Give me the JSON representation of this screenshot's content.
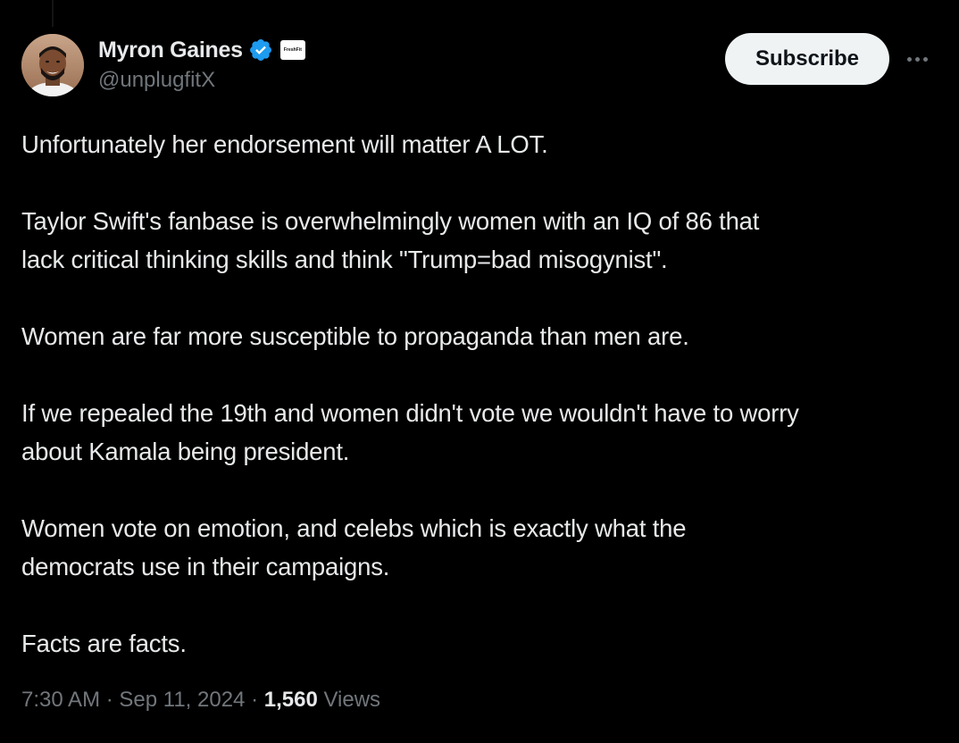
{
  "author": {
    "display_name": "Myron Gaines",
    "handle": "@unplugfitX",
    "affiliate_badge_text": "FreshFit"
  },
  "actions": {
    "subscribe_label": "Subscribe",
    "more_icon": "more-horizontal-icon"
  },
  "tweet": {
    "paragraphs": [
      "Unfortunately her endorsement will matter A LOT.",
      "Taylor Swift's fanbase is overwhelmingly women with an IQ of 86 that\nlack critical thinking skills and think \"Trump=bad misogynist\".",
      "Women are far more susceptible to propaganda than men are.",
      "If we repealed the 19th and women didn't vote we wouldn't have to worry\nabout Kamala being president.",
      "Women vote on emotion, and celebs which is exactly what the\ndemocrats use in their campaigns.",
      "Facts are facts."
    ]
  },
  "meta": {
    "time": "7:30 AM",
    "separator": " · ",
    "date": "Sep 11, 2024",
    "views_count": "1,560",
    "views_label": " Views"
  },
  "colors": {
    "background": "#000000",
    "text_primary": "#e7e9ea",
    "text_secondary": "#71767b",
    "verified_blue": "#1d9bf0",
    "button_bg": "#eff3f4"
  }
}
